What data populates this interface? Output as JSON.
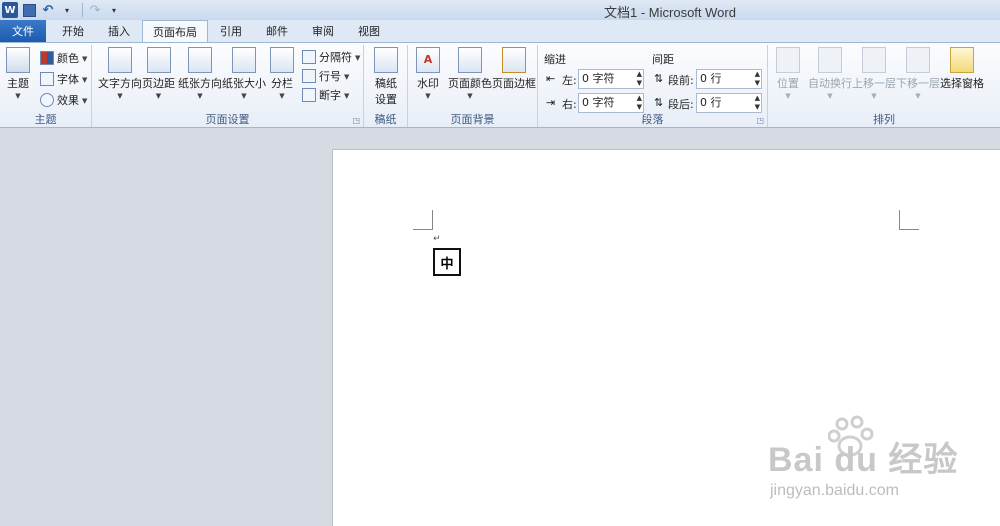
{
  "titlebar": {
    "title": "文档1 - Microsoft Word",
    "qat": [
      "word-logo",
      "save",
      "undo",
      "redo",
      "customize"
    ]
  },
  "tabs": [
    {
      "label": "文件"
    },
    {
      "label": "开始"
    },
    {
      "label": "插入"
    },
    {
      "label": "页面布局",
      "active": true
    },
    {
      "label": "引用"
    },
    {
      "label": "邮件"
    },
    {
      "label": "审阅"
    },
    {
      "label": "视图"
    }
  ],
  "ribbon": {
    "theme_group": {
      "label": "主题",
      "theme_button": "主题",
      "colors": "颜色",
      "fonts": "字体",
      "effects": "效果"
    },
    "page_setup_group": {
      "label": "页面设置",
      "text_direction": "文字方向",
      "margins": "页边距",
      "orientation": "纸张方向",
      "size": "纸张大小",
      "columns": "分栏",
      "breaks": "分隔符",
      "line_numbers": "行号",
      "hyphenation": "断字"
    },
    "manuscript_group": {
      "label": "稿纸",
      "settings_line1": "稿纸",
      "settings_line2": "设置"
    },
    "page_background_group": {
      "label": "页面背景",
      "watermark": "水印",
      "page_color": "页面颜色",
      "page_borders": "页面边框"
    },
    "paragraph_group": {
      "label": "段落",
      "indent_title": "缩进",
      "spacing_title": "间距",
      "left_label": "左:",
      "left_value": "0 字符",
      "right_label": "右:",
      "right_value": "0 字符",
      "before_label": "段前:",
      "before_value": "0 行",
      "after_label": "段后:",
      "after_value": "0 行"
    },
    "arrange_group": {
      "label": "排列",
      "position": "位置",
      "wrap_text": "自动换行",
      "bring_forward": "上移一层",
      "send_backward": "下移一层",
      "selection_pane": "选择窗格"
    }
  },
  "document": {
    "paragraph_mark": "↵",
    "boxed_char": "中"
  },
  "watermark": {
    "brand": "Bai du 经验",
    "sub": "jingyan.baidu.com"
  }
}
